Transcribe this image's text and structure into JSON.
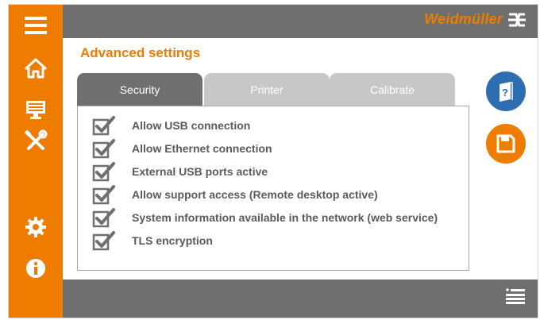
{
  "header": {
    "brand": "Weidmüller"
  },
  "page": {
    "title": "Advanced settings"
  },
  "tabs": [
    {
      "label": "Security",
      "active": true
    },
    {
      "label": "Printer",
      "active": false
    },
    {
      "label": "Calibrate",
      "active": false
    }
  ],
  "options": [
    {
      "label": "Allow USB connection",
      "checked": true
    },
    {
      "label": "Allow Ethernet connection",
      "checked": true
    },
    {
      "label": "External USB ports active",
      "checked": true
    },
    {
      "label": "Allow support access (Remote desktop active)",
      "checked": true
    },
    {
      "label": "System information available in the network (web service)",
      "checked": true
    },
    {
      "label": "TLS encryption",
      "checked": true
    }
  ],
  "sidebar": {
    "icons": [
      "menu-icon",
      "home-icon",
      "monitor-icon",
      "tools-icon",
      "gear-icon",
      "info-icon"
    ]
  },
  "actions": {
    "icons": [
      "help-icon",
      "save-icon",
      "list-icon"
    ]
  },
  "colors": {
    "accent": "#ee7c00",
    "bar": "#6f6f6f",
    "tab_inactive": "#c7c7c7",
    "help": "#2f6db3"
  }
}
